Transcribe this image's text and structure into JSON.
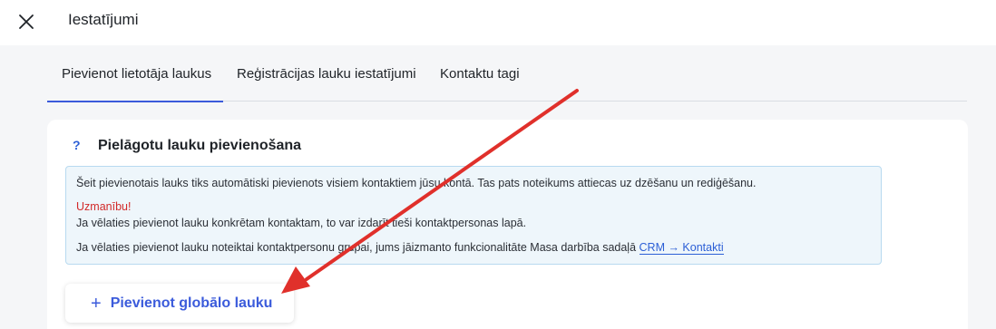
{
  "header": {
    "title": "Iestatījumi",
    "close_icon": "close-icon"
  },
  "tabs": [
    {
      "label": "Pievienot lietotāja laukus",
      "active": true
    },
    {
      "label": "Reģistrācijas lauku iestatījumi",
      "active": false
    },
    {
      "label": "Kontaktu tagi",
      "active": false
    }
  ],
  "card": {
    "help_mark": "?",
    "title": "Pielāgotu lauku pievienošana",
    "info": {
      "line1": "Šeit pievienotais lauks tiks automātiski pievienots visiem kontaktiem jūsu kontā. Tas pats noteikums attiecas uz dzēšanu un rediģēšanu.",
      "warning": "Uzmanību!",
      "line3": "Ja vēlaties pievienot lauku konkrētam kontaktam, to var izdarīt tieši kontaktpersonas lapā.",
      "line4_prefix": "Ja vēlaties pievienot lauku noteiktai kontaktpersonu grupai, jums jāizmanto funkcionalitāte Masa darbība sadaļā ",
      "link": "CRM → Kontakti"
    },
    "add_button": {
      "icon": "+",
      "label": "Pievienot globālo lauku"
    }
  },
  "colors": {
    "accent": "#3b5bdb",
    "warning": "#d22a2a",
    "annotation_arrow": "#e0302b",
    "info_bg": "#eef6fb"
  }
}
